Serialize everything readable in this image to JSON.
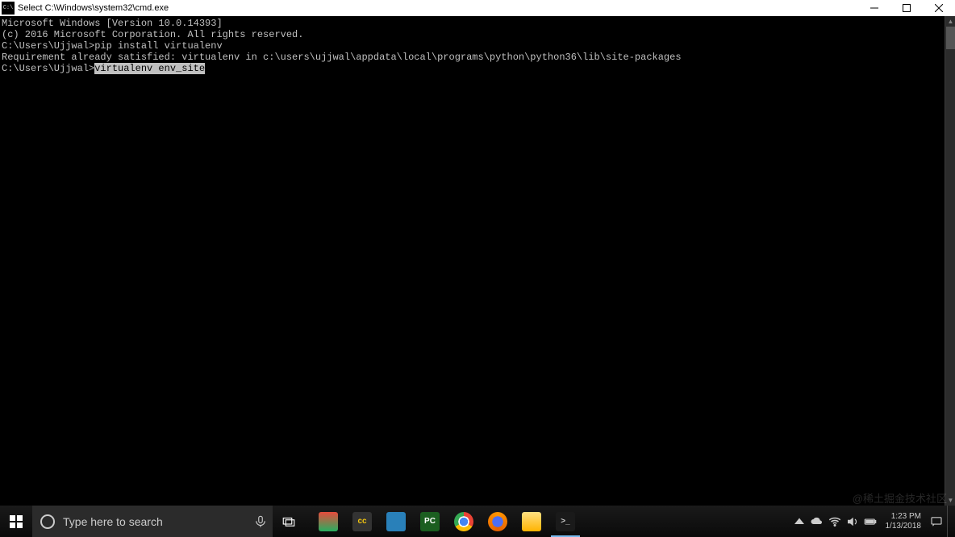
{
  "window": {
    "title": "Select C:\\Windows\\system32\\cmd.exe"
  },
  "terminal": {
    "lines": [
      "Microsoft Windows [Version 10.0.14393]",
      "(c) 2016 Microsoft Corporation. All rights reserved.",
      "",
      "C:\\Users\\Ujjwal>pip install virtualenv",
      "Requirement already satisfied: virtualenv in c:\\users\\ujjwal\\appdata\\local\\programs\\python\\python36\\lib\\site-packages",
      ""
    ],
    "active_prompt": "C:\\Users\\Ujjwal>",
    "active_command_selected": "virtualenv env_site"
  },
  "taskbar": {
    "search_placeholder": "Type here to search",
    "apps": [
      {
        "name": "microsoft-store",
        "label": "",
        "bg": "linear-gradient(#e74c3c,#27ae60)",
        "fg": "#fff"
      },
      {
        "name": "ccleaner",
        "label": "cc",
        "bg": "#333",
        "fg": "#f1c40f"
      },
      {
        "name": "downloads",
        "label": "",
        "bg": "#2980b9",
        "fg": "#fff"
      },
      {
        "name": "pycharm",
        "label": "PC",
        "bg": "#1b5e20",
        "fg": "#fff"
      },
      {
        "name": "chrome",
        "label": "",
        "bg": "radial-gradient(#4285f4 30%, #fff 30% 40%, transparent 40%), conic-gradient(#ea4335 0 120deg,#fbbc05 120deg 240deg,#34a853 240deg 360deg)",
        "fg": "#fff",
        "round": true
      },
      {
        "name": "firefox",
        "label": "",
        "bg": "radial-gradient(#4c6ef5 40%, transparent 40%), conic-gradient(#ff9500,#e66000,#ff9500)",
        "fg": "#fff",
        "round": true
      },
      {
        "name": "file-explorer",
        "label": "",
        "bg": "linear-gradient(#ffe082,#ffb300)",
        "fg": "#5d4037"
      },
      {
        "name": "cmd",
        "label": ">_",
        "bg": "#1a1a1a",
        "fg": "#ccc",
        "active": true
      }
    ]
  },
  "tray": {
    "time": "1:23 PM",
    "date": "1/13/2018"
  },
  "watermark": "@稀土掘金技术社区"
}
